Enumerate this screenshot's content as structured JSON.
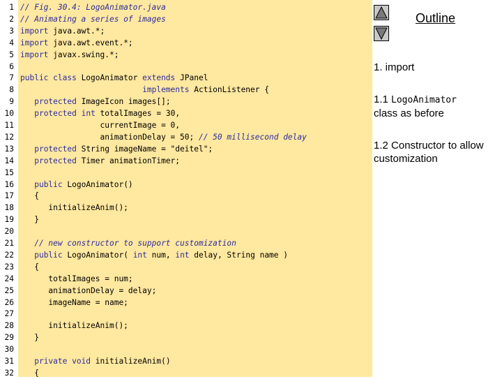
{
  "code_lines": [
    [
      [
        "cm",
        "// Fig. 30.4: LogoAnimator.java"
      ]
    ],
    [
      [
        "cm",
        "// Animating a series of images"
      ]
    ],
    [
      [
        "kw",
        "import"
      ],
      [
        "tx",
        " java.awt.*;"
      ]
    ],
    [
      [
        "kw",
        "import"
      ],
      [
        "tx",
        " java.awt.event.*;"
      ]
    ],
    [
      [
        "kw",
        "import"
      ],
      [
        "tx",
        " javax.swing.*;"
      ]
    ],
    [],
    [
      [
        "kw",
        "public class"
      ],
      [
        "tx",
        " LogoAnimator "
      ],
      [
        "kw",
        "extends"
      ],
      [
        "tx",
        " JPanel"
      ]
    ],
    [
      [
        "tx",
        "                          "
      ],
      [
        "kw",
        "implements"
      ],
      [
        "tx",
        " ActionListener {"
      ]
    ],
    [
      [
        "tx",
        "   "
      ],
      [
        "kw",
        "protected"
      ],
      [
        "tx",
        " ImageIcon images[];"
      ]
    ],
    [
      [
        "tx",
        "   "
      ],
      [
        "kw",
        "protected"
      ],
      [
        "tx",
        " "
      ],
      [
        "kw",
        "int"
      ],
      [
        "tx",
        " totalImages = 30,"
      ]
    ],
    [
      [
        "tx",
        "                 currentImage = 0,"
      ]
    ],
    [
      [
        "tx",
        "                 animationDelay = 50; "
      ],
      [
        "cm",
        "// 50 millisecond delay"
      ]
    ],
    [
      [
        "tx",
        "   "
      ],
      [
        "kw",
        "protected"
      ],
      [
        "tx",
        " String imageName = \"deitel\";"
      ]
    ],
    [
      [
        "tx",
        "   "
      ],
      [
        "kw",
        "protected"
      ],
      [
        "tx",
        " Timer animationTimer;"
      ]
    ],
    [],
    [
      [
        "tx",
        "   "
      ],
      [
        "kw",
        "public"
      ],
      [
        "tx",
        " LogoAnimator()"
      ]
    ],
    [
      [
        "tx",
        "   {"
      ]
    ],
    [
      [
        "tx",
        "      initializeAnim();"
      ]
    ],
    [
      [
        "tx",
        "   }"
      ]
    ],
    [],
    [
      [
        "tx",
        "   "
      ],
      [
        "cm",
        "// new constructor to support customization"
      ]
    ],
    [
      [
        "tx",
        "   "
      ],
      [
        "kw",
        "public"
      ],
      [
        "tx",
        " LogoAnimator( "
      ],
      [
        "kw",
        "int"
      ],
      [
        "tx",
        " num, "
      ],
      [
        "kw",
        "int"
      ],
      [
        "tx",
        " delay, String name )"
      ]
    ],
    [
      [
        "tx",
        "   {"
      ]
    ],
    [
      [
        "tx",
        "      totalImages = num;"
      ]
    ],
    [
      [
        "tx",
        "      animationDelay = delay;"
      ]
    ],
    [
      [
        "tx",
        "      imageName = name;"
      ]
    ],
    [],
    [
      [
        "tx",
        "      initializeAnim();"
      ]
    ],
    [
      [
        "tx",
        "   }"
      ]
    ],
    [],
    [
      [
        "tx",
        "   "
      ],
      [
        "kw",
        "private void"
      ],
      [
        "tx",
        " initializeAnim()"
      ]
    ],
    [
      [
        "tx",
        "   {"
      ]
    ]
  ],
  "sidebar": {
    "outline_label": "Outline",
    "item1": "1. import",
    "item2_prefix": "1.1 ",
    "item2_mono": "LogoAnimator",
    "item2_suffix": "class as before",
    "item3": "1.2 Constructor to allow customization"
  }
}
